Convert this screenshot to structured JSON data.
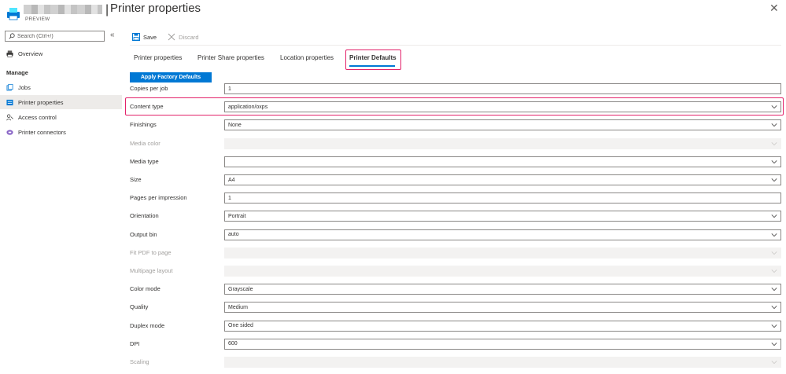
{
  "header": {
    "preview_label": "PREVIEW",
    "separator": "|",
    "title": "Printer properties",
    "close_glyph": "✕"
  },
  "sidebar": {
    "search_placeholder": "Search (Ctrl+/)",
    "collapse_glyph": "«",
    "overview": {
      "label": "Overview",
      "icon": "printer-icon"
    },
    "section_label": "Manage",
    "items": [
      {
        "label": "Jobs",
        "icon": "jobs-icon"
      },
      {
        "label": "Printer properties",
        "icon": "properties-icon",
        "active": true
      },
      {
        "label": "Access control",
        "icon": "access-control-icon"
      },
      {
        "label": "Printer connectors",
        "icon": "connector-icon"
      }
    ]
  },
  "toolbar": {
    "save_label": "Save",
    "discard_label": "Discard"
  },
  "tabs": [
    {
      "label": "Printer properties"
    },
    {
      "label": "Printer Share properties"
    },
    {
      "label": "Location properties"
    },
    {
      "label": "Printer Defaults",
      "active": true
    }
  ],
  "apply_button_label": "Apply Factory Defaults",
  "form": [
    {
      "label": "Copies per job",
      "value": "1",
      "type": "text",
      "disabled": false
    },
    {
      "label": "Content type",
      "value": "application/oxps",
      "type": "select",
      "disabled": false
    },
    {
      "label": "Finishings",
      "value": "None",
      "type": "select",
      "disabled": false
    },
    {
      "label": "Media color",
      "value": "",
      "type": "select",
      "disabled": true
    },
    {
      "label": "Media type",
      "value": "",
      "type": "select",
      "disabled": false
    },
    {
      "label": "Size",
      "value": "A4",
      "type": "select",
      "disabled": false
    },
    {
      "label": "Pages per impression",
      "value": "1",
      "type": "text",
      "disabled": false
    },
    {
      "label": "Orientation",
      "value": "Portrait",
      "type": "select",
      "disabled": false
    },
    {
      "label": "Output bin",
      "value": "auto",
      "type": "select",
      "disabled": false
    },
    {
      "label": "Fit PDF to page",
      "value": "",
      "type": "select",
      "disabled": true
    },
    {
      "label": "Multipage layout",
      "value": "",
      "type": "select",
      "disabled": true
    },
    {
      "label": "Color mode",
      "value": "Grayscale",
      "type": "select",
      "disabled": false
    },
    {
      "label": "Quality",
      "value": "Medium",
      "type": "select",
      "disabled": false
    },
    {
      "label": "Duplex mode",
      "value": "One sided",
      "type": "select",
      "disabled": false
    },
    {
      "label": "DPI",
      "value": "600",
      "type": "select",
      "disabled": false
    },
    {
      "label": "Scaling",
      "value": "",
      "type": "select",
      "disabled": true
    }
  ],
  "colors": {
    "accent": "#0078d4",
    "highlight": "#e3226a",
    "active_nav_bg": "#edebe9"
  }
}
